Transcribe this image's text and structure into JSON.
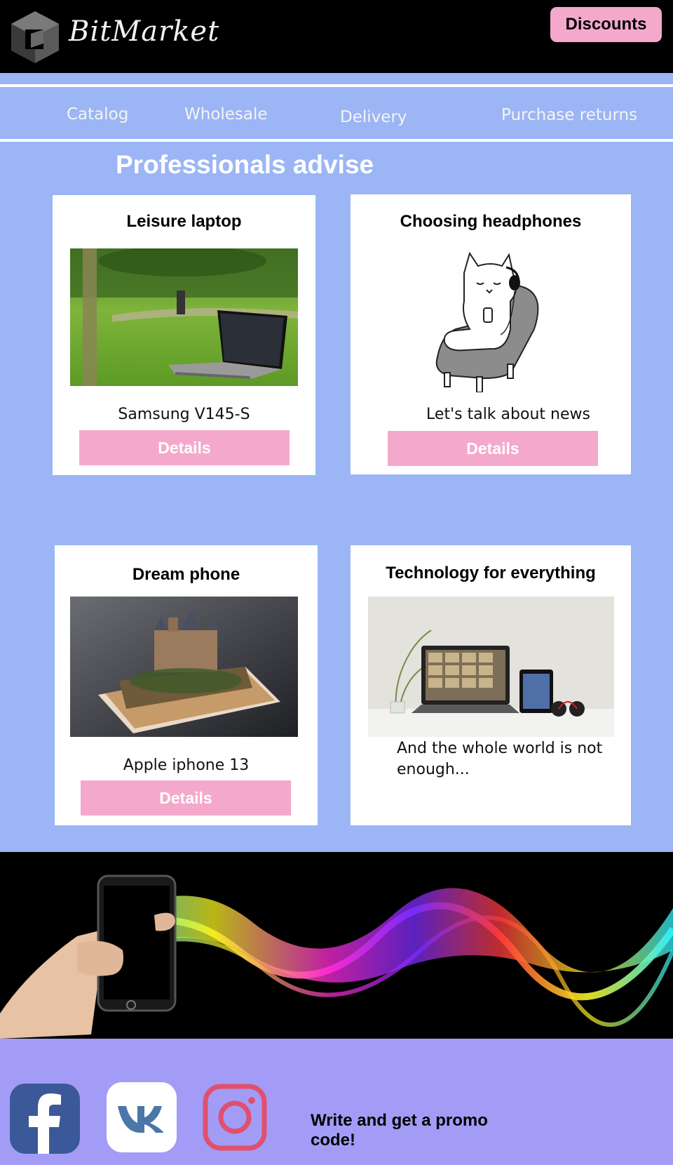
{
  "header": {
    "brand": "BitMarket",
    "discounts_label": "Discounts"
  },
  "nav": {
    "items": [
      {
        "label": "Catalog"
      },
      {
        "label": "Wholesale"
      },
      {
        "label": "Delivery"
      },
      {
        "label": "Purchase returns"
      }
    ]
  },
  "main": {
    "section_title": "Professionals advise",
    "cards": [
      {
        "title": "Leisure laptop",
        "text": "Samsung V145-S",
        "button": "Details",
        "image": "laptop-on-grass-photo"
      },
      {
        "title": "Choosing headphones",
        "text": "Let's talk about news",
        "button": "Details",
        "image": "cat-with-headphones-illustration"
      },
      {
        "title": "Dream phone",
        "text": "Apple iphone 13",
        "button": "Details",
        "image": "phone-with-castle-photo"
      },
      {
        "title": "Technology for everything",
        "text": "And the whole world is not enough...",
        "image": "laptop-tablet-headphones-photo"
      }
    ]
  },
  "banner": {
    "image": "hand-holding-phone-color-waves"
  },
  "footer": {
    "social": [
      {
        "name": "facebook-icon",
        "color": "#3b5998"
      },
      {
        "name": "vk-icon",
        "color": "#4a76a8"
      },
      {
        "name": "instagram-icon",
        "color": "#e1306c"
      }
    ],
    "promo_text": "Write and get a promo code!"
  },
  "colors": {
    "background": "#9bb5f5",
    "accent_pink": "#f4a9cc",
    "footer": "#a39cf6",
    "header": "#000000"
  }
}
